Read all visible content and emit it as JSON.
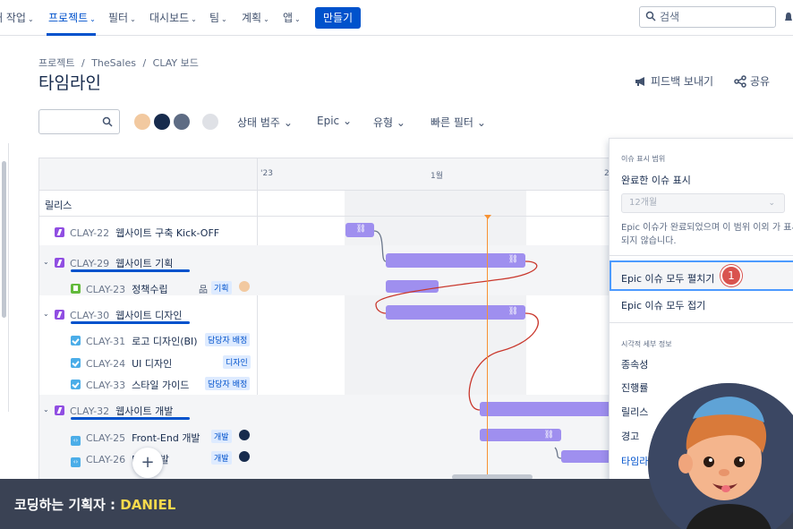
{
  "nav": {
    "items": [
      {
        "label": "내 작업",
        "chev": true
      },
      {
        "label": "프로젝트",
        "chev": true,
        "active": true
      },
      {
        "label": "필터",
        "chev": true
      },
      {
        "label": "대시보드",
        "chev": true
      },
      {
        "label": "팀",
        "chev": true
      },
      {
        "label": "계획",
        "chev": true
      },
      {
        "label": "앱",
        "chev": true
      }
    ],
    "create_label": "만들기",
    "search_placeholder": "검색"
  },
  "breadcrumb": [
    "프로젝트",
    "/",
    "TheSales",
    "/",
    "CLAY 보드"
  ],
  "page_title": "타임라인",
  "header_actions": {
    "feedback": "피드백 보내기",
    "share": "공유"
  },
  "filters": {
    "status_category": "상태 범주",
    "epic": "Epic",
    "type": "유형",
    "quick_filter": "빠른 필터"
  },
  "timeline": {
    "months": [
      "'23",
      "1월",
      "2"
    ],
    "release_label": "릴리스",
    "rows": [
      {
        "key": "CLAY-22",
        "title": "웹사이트 구축 Kick-OFF",
        "type": "epic"
      },
      {
        "key": "CLAY-29",
        "title": "웹사이트 기획",
        "type": "epic",
        "expandable": true
      },
      {
        "key": "CLAY-23",
        "title": "정책수립",
        "type": "story",
        "label": "기획"
      },
      {
        "key": "CLAY-30",
        "title": "웹사이트 디자인",
        "type": "epic",
        "expandable": true
      },
      {
        "key": "CLAY-31",
        "title": "로고 디자인(BI)",
        "type": "task",
        "label": "담당자 배정"
      },
      {
        "key": "CLAY-24",
        "title": "UI 디자인",
        "type": "task",
        "label": "디자인"
      },
      {
        "key": "CLAY-33",
        "title": "스타일 가이드",
        "type": "task",
        "label": "담당자 배정"
      },
      {
        "key": "CLAY-32",
        "title": "웹사이트 개발",
        "type": "epic",
        "expandable": true
      },
      {
        "key": "CLAY-25",
        "title": "Front-End 개발",
        "type": "code",
        "label": "개발"
      },
      {
        "key": "CLAY-26",
        "title": "B    d 개발",
        "type": "code",
        "label": "개발"
      }
    ]
  },
  "panel": {
    "section_issue_range": "이슈 표시 범위",
    "show_completed": "완료한 이슈 표시",
    "select_value": "12개월",
    "help_text": "Epic 이슈가 완료되었으며 이 범위 이외 가 표시되지 않습니다.",
    "expand_all": "Epic 이슈 모두 펼치기",
    "collapse_all": "Epic 이슈 모두 접기",
    "section_visual": "시각적 세부 정보",
    "visual_items": [
      "종속성",
      "진행률",
      "릴리스",
      "경고",
      "타임라인"
    ],
    "badge": "1"
  },
  "banner": {
    "prefix": "코딩하는 기획자 : ",
    "name": "DANIEL"
  }
}
